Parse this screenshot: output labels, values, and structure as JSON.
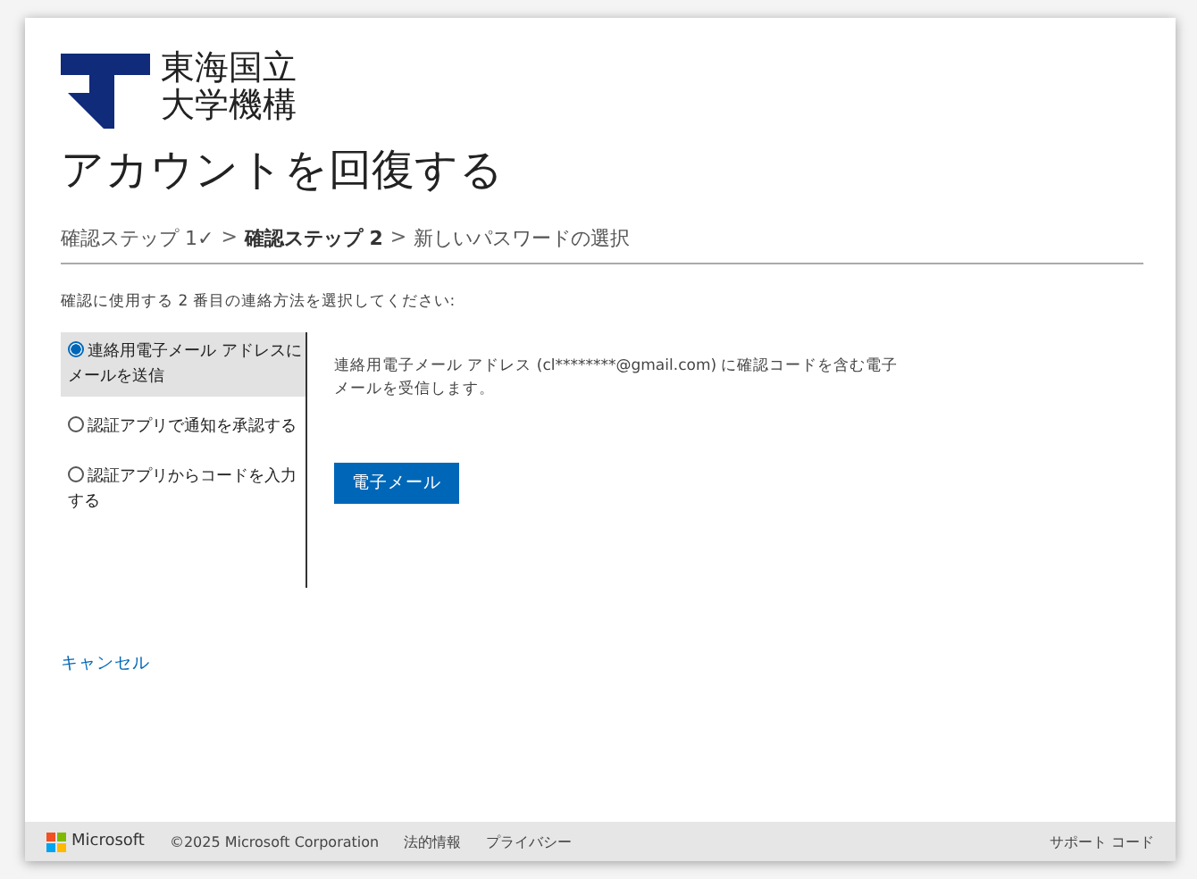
{
  "logo": {
    "lines": [
      "東海国立",
      "大学機構"
    ]
  },
  "title": "アカウントを回復する",
  "breadcrumb": [
    {
      "label": "確認ステップ 1",
      "done": true,
      "selected": false
    },
    {
      "label": "確認ステップ 2",
      "done": false,
      "selected": true
    },
    {
      "label": "新しいパスワードの選択",
      "done": false,
      "selected": false
    }
  ],
  "breadcrumb_done_mark": "✓",
  "breadcrumb_separator": ">",
  "instruction": "確認に使用する 2 番目の連絡方法を選択してください:",
  "options": [
    {
      "label": "連絡用電子メール アドレスにメールを送信",
      "selected": true
    },
    {
      "label": "認証アプリで通知を承認する",
      "selected": false
    },
    {
      "label": "認証アプリからコードを入力する",
      "selected": false
    }
  ],
  "description": "連絡用電子メール アドレス (cl********@gmail.com) に確認コードを含む電子メールを受信します。",
  "action_button": "電子メール",
  "cancel_link": "キャンセル",
  "footer": {
    "brand": "Microsoft",
    "copyright": "©2025 Microsoft Corporation",
    "links": [
      "法的情報",
      "プライバシー"
    ],
    "support": "サポート コード"
  }
}
